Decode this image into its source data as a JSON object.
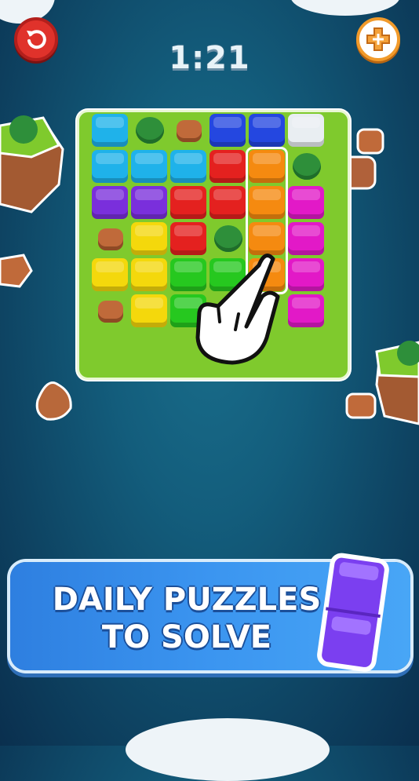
{
  "hud": {
    "timer": "1:21",
    "restart_icon": "restart-icon",
    "hint_icon": "puzzle-piece-plus-icon"
  },
  "board": {
    "rows": 6,
    "cols": 6,
    "cells": [
      [
        "cyan",
        "grass",
        "rock",
        "blue",
        "blue",
        "white"
      ],
      [
        "cyan",
        "cyan",
        "cyan",
        "red",
        "orange",
        "grass"
      ],
      [
        "purple",
        "purple",
        "red",
        "red",
        "orange",
        "magenta"
      ],
      [
        "rock",
        "yellow",
        "red",
        "grass",
        "orange",
        "magenta"
      ],
      [
        "yellow",
        "yellow",
        "green",
        "green",
        "orange",
        "magenta"
      ],
      [
        "rock",
        "yellow",
        "green",
        "hand",
        "hand",
        "magenta"
      ]
    ],
    "colors": {
      "cyan": "#1fb2ea",
      "blue": "#2447e0",
      "white": "#e9eef2",
      "orange": "#f58a10",
      "red": "#e4211f",
      "purple": "#7a2fdc",
      "magenta": "#e219c7",
      "yellow": "#f4d80c",
      "green": "#26c81f"
    }
  },
  "tutorial": {
    "icon": "pointing-hand-icon"
  },
  "banner": {
    "line1": "DAILY PUZZLES",
    "line2": "TO SOLVE",
    "piece_color": "#7b3ff0"
  }
}
